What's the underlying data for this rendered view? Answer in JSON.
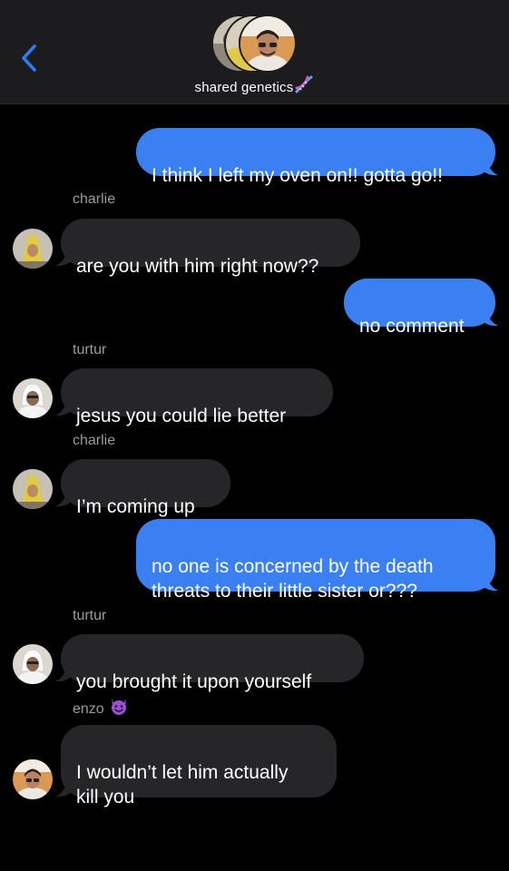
{
  "header": {
    "back_icon": "chevron-left-icon",
    "group_name": "shared genetics",
    "group_emoji": "dna-icon"
  },
  "colors": {
    "outgoing_bubble": "#3a80f3",
    "incoming_bubble": "#262628",
    "accent": "#2f7cf6",
    "background": "#000000"
  },
  "messages": [
    {
      "direction": "out",
      "text": "I think I left my oven on!! gotta go!!"
    },
    {
      "direction": "in",
      "sender": "charlie",
      "text": "are you with him right now??"
    },
    {
      "direction": "out",
      "text": "no comment"
    },
    {
      "direction": "in",
      "sender": "turtur",
      "text": "jesus you could lie better"
    },
    {
      "direction": "in",
      "sender": "charlie",
      "text": "I’m coming up"
    },
    {
      "direction": "out",
      "text": "no one is concerned by the death\nthreats to their little sister or???"
    },
    {
      "direction": "in",
      "sender": "turtur",
      "text": "you brought it upon yourself"
    },
    {
      "direction": "in",
      "sender": "enzo",
      "sender_emoji": "smiling-devil-icon",
      "text": "I wouldn’t let him actually\nkill you"
    }
  ]
}
